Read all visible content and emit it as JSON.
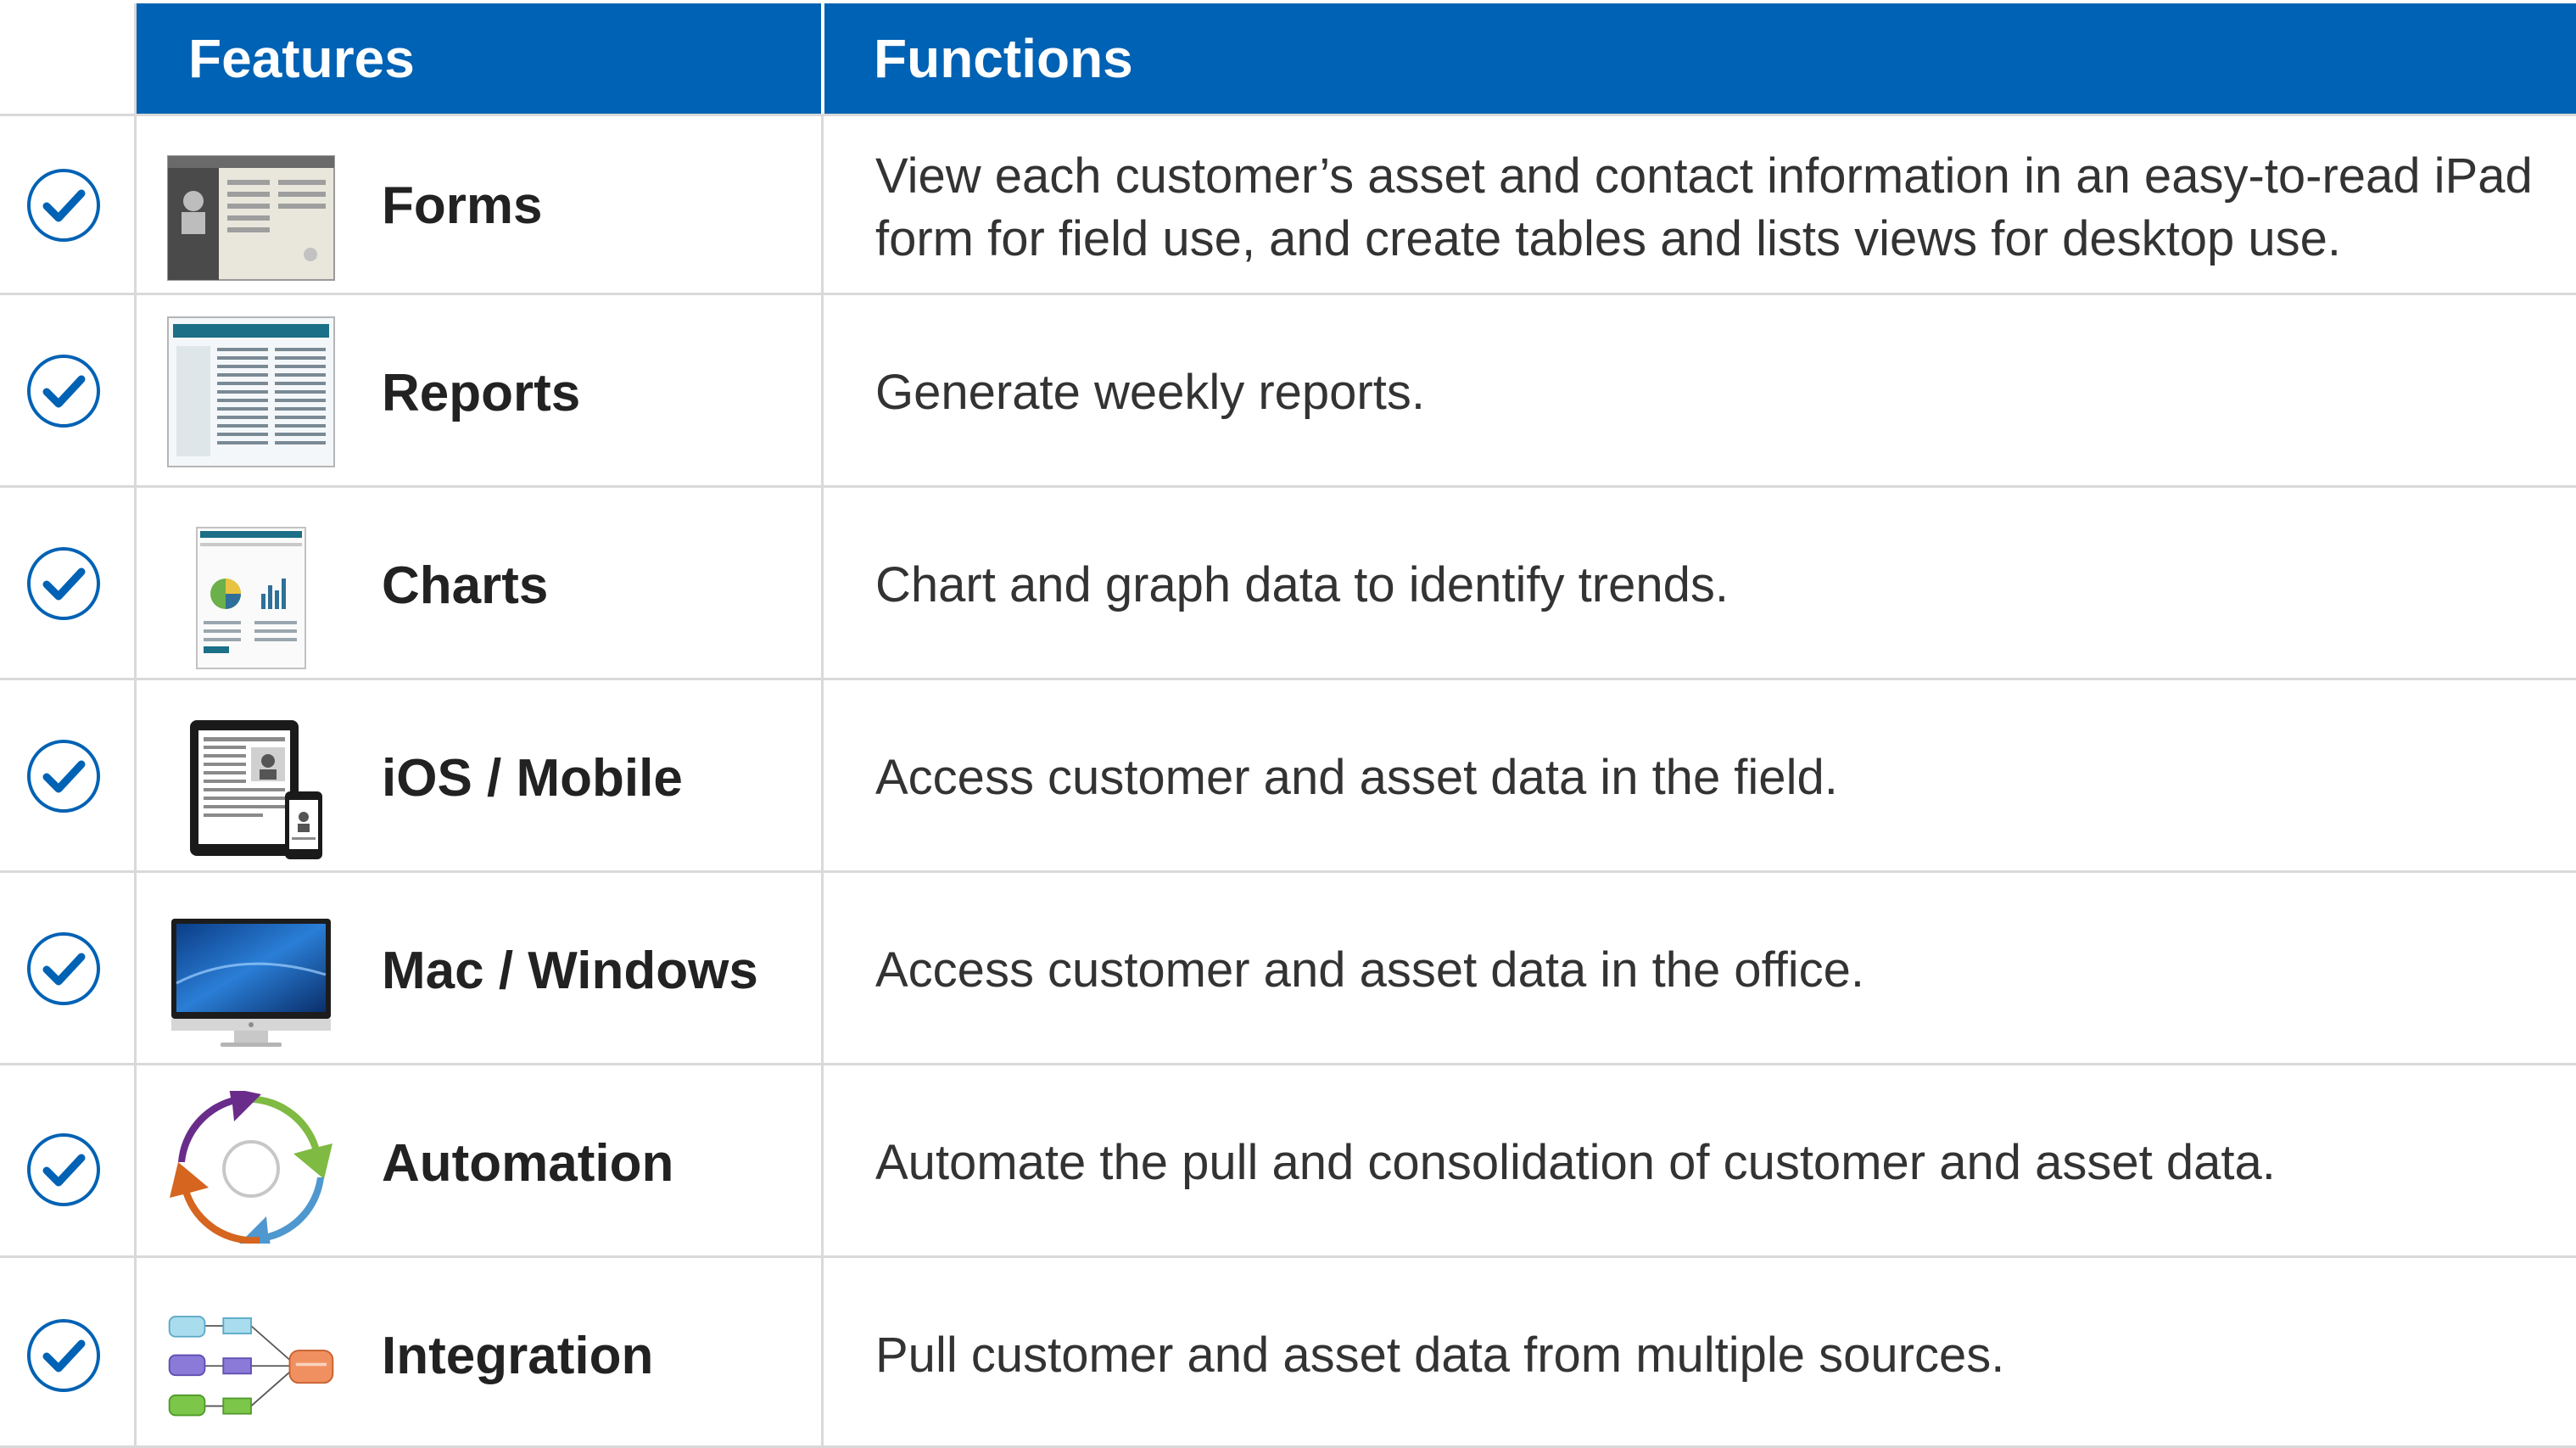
{
  "header": {
    "features": "Features",
    "functions": "Functions"
  },
  "colors": {
    "header_bg": "#0062b4",
    "check": "#0062b4",
    "grid": "#d9d9d9"
  },
  "rows": [
    {
      "feature": "Forms",
      "function": "View each customer’s asset and contact information in an easy-to-read iPad form for field use, and create tables and lists views for desktop use.",
      "icon": "forms-screenshot-icon"
    },
    {
      "feature": "Reports",
      "function": "Generate weekly reports.",
      "icon": "reports-screenshot-icon"
    },
    {
      "feature": "Charts",
      "function": "Chart and graph data to identify trends.",
      "icon": "charts-screenshot-icon"
    },
    {
      "feature": "iOS / Mobile",
      "function": "Access customer and asset data in the field.",
      "icon": "ipad-iphone-icon"
    },
    {
      "feature": "Mac / Windows",
      "function": "Access customer and asset data in the office.",
      "icon": "desktop-monitor-icon"
    },
    {
      "feature": "Automation",
      "function": "Automate the pull and consolidation of customer and asset data.",
      "icon": "automation-cycle-icon"
    },
    {
      "feature": "Integration",
      "function": "Pull customer and asset data from multiple sources.",
      "icon": "integration-databases-icon"
    }
  ]
}
